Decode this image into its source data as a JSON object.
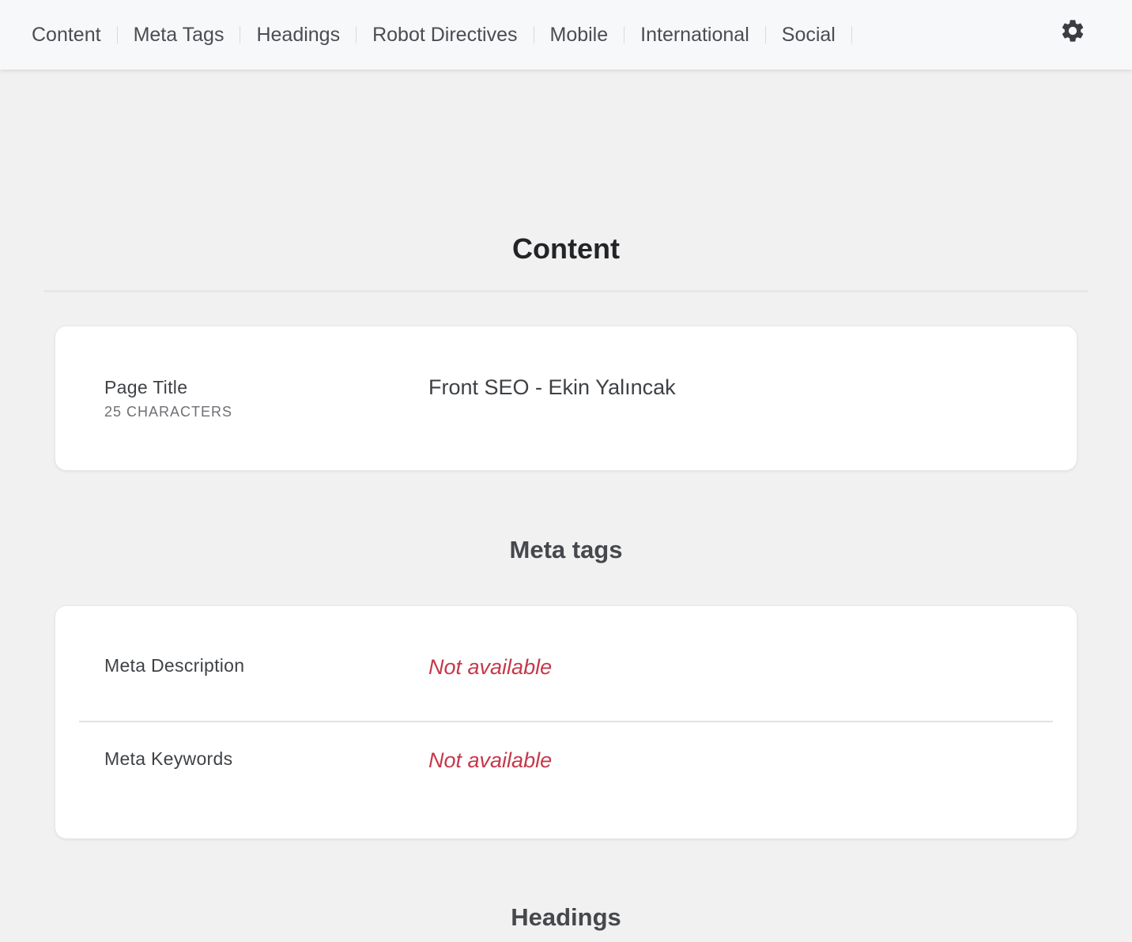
{
  "nav": {
    "items": [
      {
        "label": "Content"
      },
      {
        "label": "Meta Tags"
      },
      {
        "label": "Headings"
      },
      {
        "label": "Robot Directives"
      },
      {
        "label": "Mobile"
      },
      {
        "label": "International"
      },
      {
        "label": "Social"
      }
    ],
    "settings_icon": "gear-icon"
  },
  "sections": {
    "content": {
      "title": "Content",
      "page_title": {
        "label": "Page Title",
        "sublabel": "25 CHARACTERS",
        "value": "Front SEO - Ekin Yalıncak"
      }
    },
    "meta_tags": {
      "title": "Meta tags",
      "rows": [
        {
          "label": "Meta Description",
          "value": "Not available"
        },
        {
          "label": "Meta Keywords",
          "value": "Not available"
        }
      ]
    },
    "headings": {
      "title": "Headings"
    }
  },
  "colors": {
    "not_available": "#c5384a",
    "background": "#f1f1f1",
    "topbar": "#f7f8fa"
  }
}
